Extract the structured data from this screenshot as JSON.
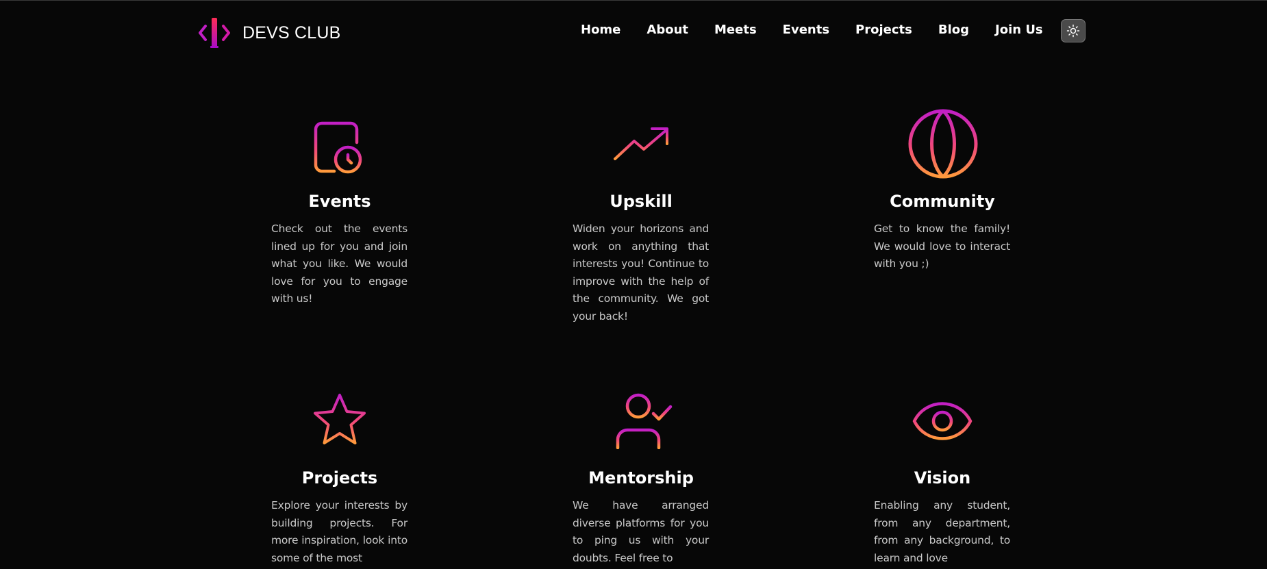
{
  "brand": {
    "name": "DEVS CLUB",
    "logo_icon": "code-brackets-logo-icon"
  },
  "nav": {
    "items": [
      {
        "label": "Home"
      },
      {
        "label": "About"
      },
      {
        "label": "Meets"
      },
      {
        "label": "Events"
      },
      {
        "label": "Projects"
      },
      {
        "label": "Blog"
      },
      {
        "label": "Join Us"
      }
    ],
    "theme_toggle_icon": "sun-icon"
  },
  "colors": {
    "background": "#070707",
    "gradient_start": "#c21fc6",
    "gradient_end": "#ff9a3c",
    "text_muted": "#c9c9c9"
  },
  "features": [
    {
      "icon": "calendar-clock-icon",
      "title": "Events",
      "description": "Check out the events lined up for you and join what you like. We would love for you to engage with us!"
    },
    {
      "icon": "trending-up-icon",
      "title": "Upskill",
      "description": "Widen your horizons and work on anything that interests you! Continue to improve with the help of the community. We got your back!"
    },
    {
      "icon": "globe-icon",
      "title": "Community",
      "description": "Get to know the family! We would love to interact with you ;)"
    },
    {
      "icon": "star-icon",
      "title": "Projects",
      "description": "Explore your interests by building projects. For more inspiration, look into some of the most"
    },
    {
      "icon": "user-check-icon",
      "title": "Mentorship",
      "description": "We have arranged diverse platforms for you to ping us with your doubts. Feel free to"
    },
    {
      "icon": "eye-icon",
      "title": "Vision",
      "description": "Enabling any student, from any department, from any background, to learn and love"
    }
  ]
}
